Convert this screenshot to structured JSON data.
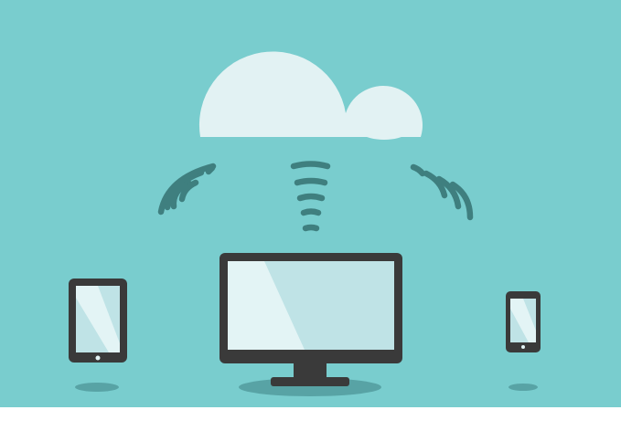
{
  "illustration": {
    "subject": "cloud-sync",
    "icons": [
      "cloud-icon",
      "wifi-signal-icon",
      "tablet-icon",
      "monitor-icon",
      "smartphone-icon"
    ],
    "colors": {
      "background": "#79CDCE",
      "cloud": "#E2F2F3",
      "signal": "#3F7F7F",
      "device_frame": "#3A3A3A",
      "screen": "#BFE3E6",
      "screen_highlight": "#E3F4F5",
      "shadow": "#58A3A5"
    }
  }
}
